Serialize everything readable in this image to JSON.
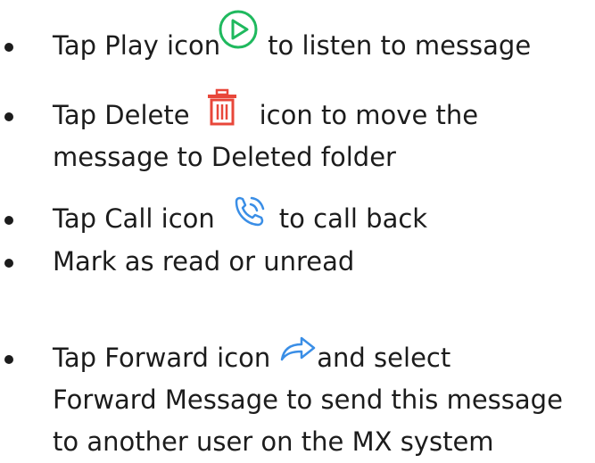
{
  "items": [
    {
      "pre": "Tap Play icon",
      "icon": "play-circle-icon",
      "post": "to listen to message"
    },
    {
      "pre": "Tap Delete",
      "icon": "trash-icon",
      "post": "icon to move the",
      "line2": "message to Deleted folder"
    },
    {
      "pre": "Tap Call icon",
      "icon": "phone-call-icon",
      "post": "to call back"
    },
    {
      "text": "Mark as read or unread"
    },
    {
      "pre": "Tap Forward icon",
      "icon": "forward-arrow-icon",
      "post": "and select",
      "line2": "Forward Message to send this message",
      "line3": "to another user on the MX system"
    }
  ],
  "colors": {
    "text": "#1c1c1c",
    "play": "#1fb95e",
    "delete": "#e8473a",
    "call": "#3a8ee6",
    "forward": "#3a8ee6"
  }
}
